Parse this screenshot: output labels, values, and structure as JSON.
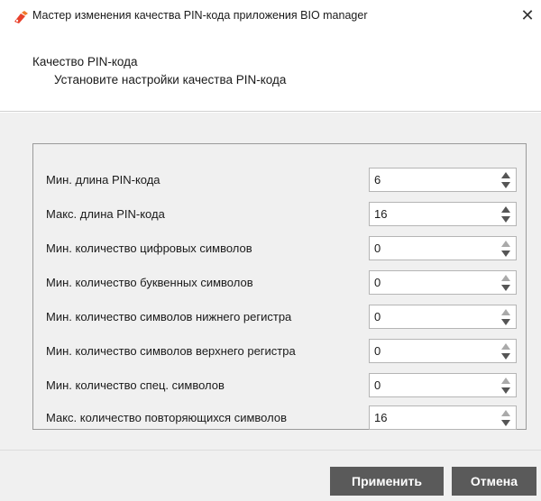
{
  "window": {
    "title": "Мастер изменения качества PIN-кода приложения BIO manager",
    "close_glyph": "✕",
    "icon": "bio-manager-app-icon"
  },
  "header": {
    "title": "Качество PIN-кода",
    "subtitle": "Установите настройки качества PIN-кода"
  },
  "settings": [
    {
      "label": "Мин. длина PIN-кода",
      "value": "6"
    },
    {
      "label": "Макс. длина PIN-кода",
      "value": "16"
    },
    {
      "label": "Мин. количество цифровых символов",
      "value": "0"
    },
    {
      "label": "Мин. количество буквенных символов",
      "value": "0"
    },
    {
      "label": "Мин. количество символов нижнего регистра",
      "value": "0"
    },
    {
      "label": "Мин. количество символов верхнего регистра",
      "value": "0"
    },
    {
      "label": "Мин. количество спец. символов",
      "value": "0"
    },
    {
      "label": "Макс. количество повторяющихся символов",
      "value": "16"
    }
  ],
  "footer": {
    "apply_label": "Применить",
    "cancel_label": "Отмена"
  },
  "colors": {
    "button_bg": "#5a5a5a",
    "content_bg": "#f0f0f0",
    "app_icon_red": "#e8412c"
  }
}
